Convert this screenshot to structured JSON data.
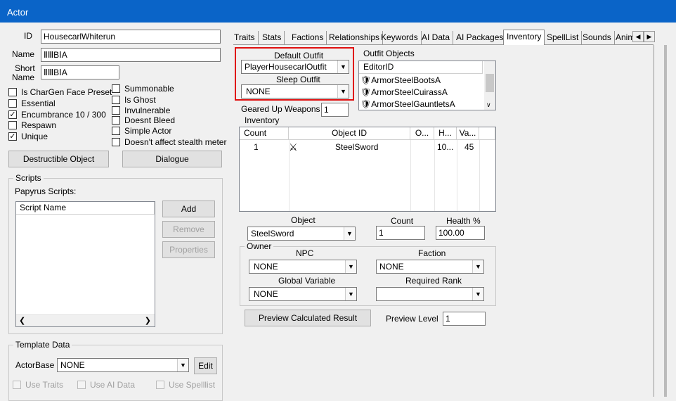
{
  "window": {
    "title": "Actor"
  },
  "identity": {
    "id_label": "ID",
    "id_value": "HousecarlWhiterun",
    "name_label": "Name",
    "name_value": "ⅡⅢBⅠA",
    "short_label_1": "Short",
    "short_label_2": "Name",
    "short_value": "ⅡⅢBⅠA"
  },
  "flags_left": [
    {
      "label": "Is CharGen Face Preset",
      "checked": false
    },
    {
      "label": "Essential",
      "checked": false
    },
    {
      "label": "Encumbrance 10 / 300",
      "checked": true
    },
    {
      "label": "Respawn",
      "checked": false
    },
    {
      "label": "Unique",
      "checked": true
    }
  ],
  "flags_right": [
    {
      "label": "Summonable",
      "checked": false
    },
    {
      "label": "Is Ghost",
      "checked": false
    },
    {
      "label": "Invulnerable",
      "checked": false
    },
    {
      "label": "Doesnt Bleed",
      "checked": false
    },
    {
      "label": "Simple Actor",
      "checked": false
    },
    {
      "label": "Doesn't affect stealth meter",
      "checked": false
    }
  ],
  "buttons": {
    "destructible": "Destructible Object",
    "dialogue": "Dialogue"
  },
  "scripts": {
    "group_label": "Scripts",
    "papyrus_label": "Papyrus Scripts:",
    "column": "Script Name",
    "add": "Add",
    "remove": "Remove",
    "properties": "Properties"
  },
  "template": {
    "group_label": "Template Data",
    "actorbase_label": "ActorBase",
    "actorbase_value": "NONE",
    "edit": "Edit",
    "use_traits": "Use Traits",
    "use_ai_data": "Use AI Data",
    "use_spelllist": "Use Spelllist"
  },
  "tabs": [
    "Traits",
    "Stats",
    "Factions",
    "Relationships",
    "Keywords",
    "AI Data",
    "AI Packages",
    "Inventory",
    "SpellList",
    "Sounds",
    "Anim"
  ],
  "tab_scroll": {
    "left": "◀",
    "right": "▶"
  },
  "outfits": {
    "default_label": "Default Outfit",
    "default_value": "PlayerHousecarlOutfit",
    "sleep_label": "Sleep Outfit",
    "sleep_value": "NONE",
    "objects_label": "Outfit Objects",
    "objects_column": "EditorID",
    "objects": [
      "ArmorSteelBootsA",
      "ArmorSteelCuirassA",
      "ArmorSteelGauntletsA"
    ]
  },
  "geared": {
    "label": "Geared Up Weapons",
    "value": "1"
  },
  "inventory": {
    "label": "Inventory",
    "columns": [
      "Count",
      "Object ID",
      "O...",
      "H...",
      "Va..."
    ],
    "rows": [
      {
        "count": "1",
        "object_id": "SteelSword",
        "owner": "",
        "health": "10...",
        "value": "45"
      }
    ]
  },
  "object_edit": {
    "object_label": "Object",
    "object_value": "SteelSword",
    "count_label": "Count",
    "count_value": "1",
    "health_label": "Health %",
    "health_value": "100.00"
  },
  "owner": {
    "group_label": "Owner",
    "npc_label": "NPC",
    "npc_value": "NONE",
    "faction_label": "Faction",
    "faction_value": "NONE",
    "global_label": "Global Variable",
    "global_value": "NONE",
    "rank_label": "Required Rank",
    "rank_value": ""
  },
  "preview": {
    "button": "Preview Calculated Result",
    "level_label": "Preview Level",
    "level_value": "1"
  },
  "colors": {
    "titlebar": "#0a64c8",
    "highlight": "#e01010"
  }
}
